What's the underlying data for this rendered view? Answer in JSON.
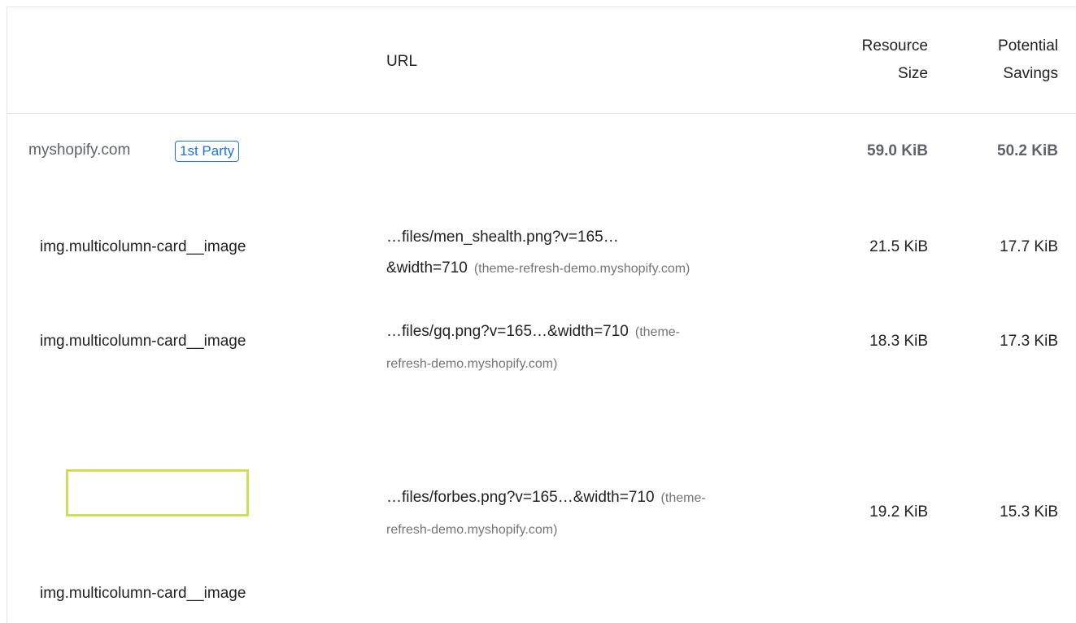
{
  "columns": {
    "url": "URL",
    "resource_size": [
      "Resource",
      "Size"
    ],
    "potential_savings": [
      "Potential",
      "Savings"
    ]
  },
  "group": {
    "name": "myshopify.com",
    "badge": "1st Party",
    "resource_size": "59.0 KiB",
    "potential_savings": "50.2 KiB"
  },
  "rows": [
    {
      "node": "img.multicolumn-card__image",
      "url_line1": "…files/men_shealth.png?v=165…",
      "url_line2": "&width=710",
      "host": "(theme-refresh-demo.myshopify.com)",
      "resource_size": "21.5 KiB",
      "potential_savings": "17.7 KiB"
    },
    {
      "node": "img.multicolumn-card__image",
      "url_line1": "…files/gq.png?v=165…&width=710",
      "host_part1": "(theme-",
      "host_part2": "refresh-demo.myshopify.com)",
      "resource_size": "18.3 KiB",
      "potential_savings": "17.3 KiB"
    },
    {
      "node": "img.multicolumn-card__image",
      "url_line1": "…files/forbes.png?v=165…&width=710",
      "host_part1": "(theme-",
      "host_part2": "refresh-demo.myshopify.com)",
      "resource_size": "19.2 KiB",
      "potential_savings": "15.3 KiB"
    }
  ],
  "colors": {
    "accent": "#1a73e8",
    "thumbnail_border": "#d2dc55",
    "muted_text": "#5f6368",
    "divider": "#e6e6e6"
  }
}
